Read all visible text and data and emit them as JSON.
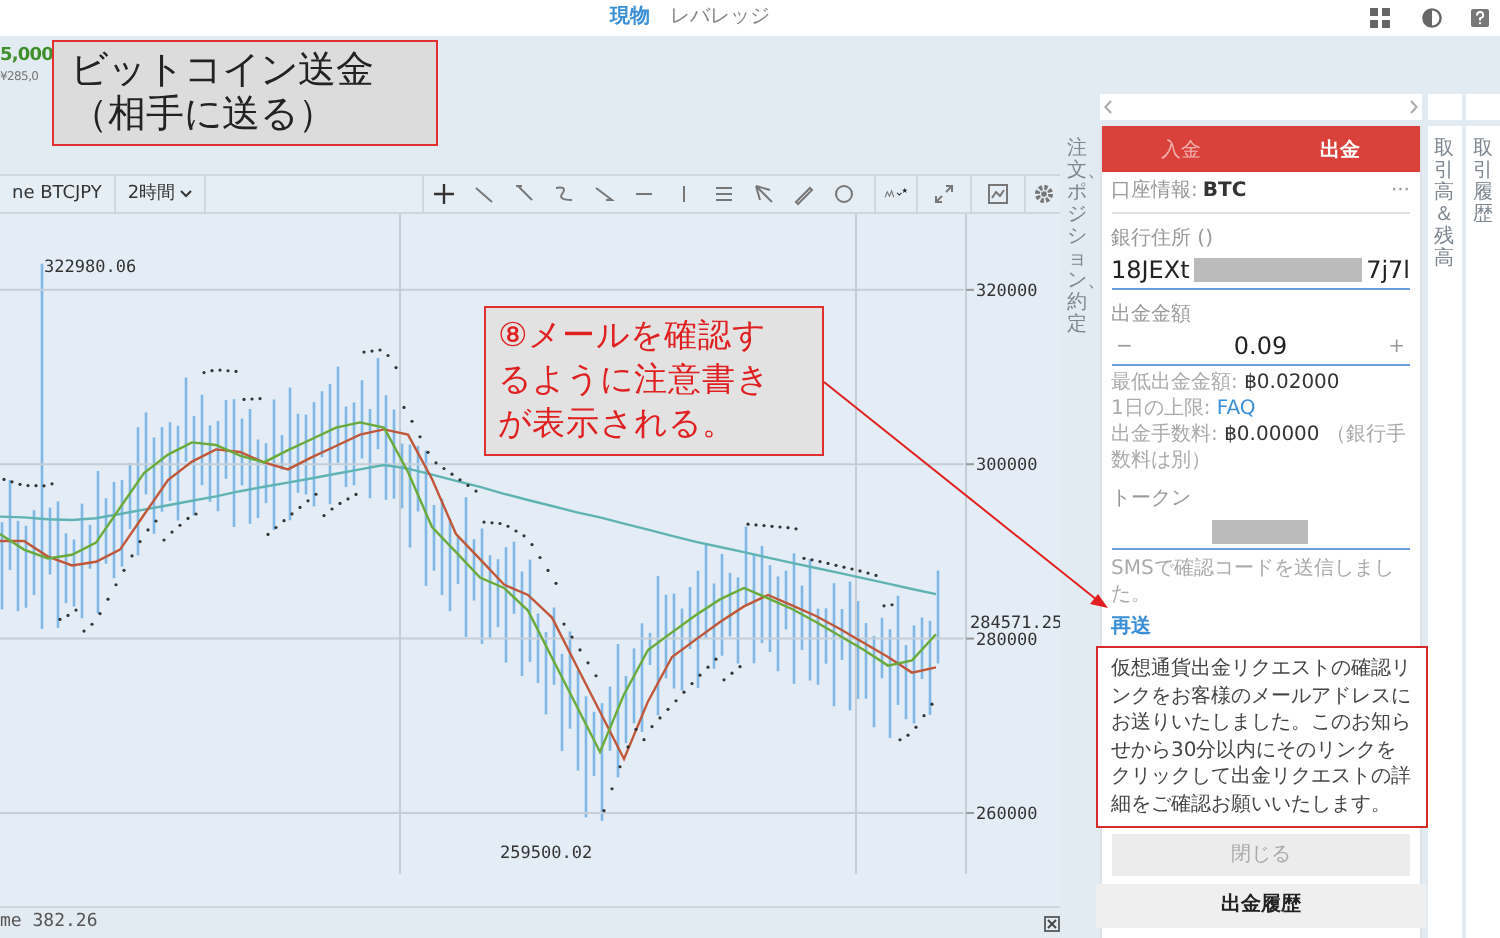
{
  "top_nav": {
    "tabs": [
      {
        "label": "現物",
        "selected": true
      },
      {
        "label": "レバレッジ",
        "selected": false
      }
    ]
  },
  "ticker": {
    "price": "5,000",
    "sub_price": "¥285,0"
  },
  "callout_title": {
    "lines": [
      "ビットコイン送金",
      "（相手に送る）"
    ]
  },
  "callout_note": {
    "lines": [
      "⑧メールを確認す",
      "るように注意書き",
      "が表示される。"
    ]
  },
  "chart": {
    "symbol": "ne BTCJPY",
    "interval": "2時間",
    "high_label": "322980.06",
    "low_label": "259500.02",
    "last_price": "284571.25",
    "volume_label": "me 382.26",
    "chart_data": {
      "type": "line",
      "grid": true,
      "yticks": [
        260000,
        280000,
        300000,
        320000
      ],
      "ylim": [
        253000,
        328700
      ],
      "series": [
        {
          "color": "#5fb3b3",
          "values": [
            294000,
            293900,
            293700,
            293600,
            293800,
            294300,
            294800,
            295300,
            295800,
            296300,
            296900,
            297400,
            297900,
            298400,
            298900,
            299400,
            299900,
            299500,
            298800,
            298100,
            297400,
            296600,
            295900,
            295200,
            294500,
            293900,
            293200,
            292500,
            291800,
            291100,
            290500,
            289900,
            289300,
            288700,
            288100,
            287500,
            286900,
            286300,
            285700,
            285100
          ]
        },
        {
          "color": "#c0573a",
          "values": [
            291200,
            291200,
            289400,
            288400,
            288800,
            290200,
            294200,
            298200,
            300300,
            301700,
            301400,
            300200,
            299400,
            300800,
            302100,
            303400,
            304000,
            303400,
            298300,
            292000,
            289100,
            286200,
            285000,
            282400,
            277000,
            271600,
            266200,
            272800,
            277900,
            279900,
            281900,
            283700,
            285000,
            283800,
            282600,
            281100,
            279500,
            277900,
            276100,
            276700
          ]
        },
        {
          "color": "#6aaa3a",
          "values": [
            292000,
            290200,
            289200,
            289600,
            291000,
            295000,
            299000,
            301100,
            302500,
            302200,
            301000,
            300200,
            301600,
            302900,
            304200,
            304800,
            304200,
            299100,
            292800,
            289900,
            287000,
            285800,
            283200,
            277800,
            272400,
            267000,
            273600,
            278700,
            280700,
            282700,
            284500,
            285800,
            284600,
            283400,
            281900,
            280300,
            278700,
            276900,
            277500,
            280500
          ]
        }
      ]
    }
  },
  "left_side_tab": {
    "label": "注文、ポジション、約定"
  },
  "right_side_tabs": [
    {
      "label": "取引高＆残高"
    },
    {
      "label": "取引履歴"
    }
  ],
  "panel": {
    "tabs": [
      {
        "label": "入金",
        "selected": false
      },
      {
        "label": "出金",
        "selected": true
      }
    ],
    "account_label": "口座情報:",
    "account_value": "BTC",
    "more": "···",
    "address": {
      "label": "銀行住所 ()",
      "value_start": "18JEXt",
      "value_end": "7j7l"
    },
    "amount": {
      "label": "出金金額",
      "minus": "−",
      "value": "0.09",
      "plus": "+"
    },
    "info": [
      {
        "label": "最低出金金額:",
        "value": "฿0.02000",
        "kind": "value"
      },
      {
        "label": "1日の上限:",
        "value": "FAQ",
        "kind": "link"
      },
      {
        "label": "出金手数料:",
        "value": "฿0.00000",
        "note": "（銀行手数料は別）",
        "kind": "value"
      }
    ],
    "token": {
      "label": "トークン"
    },
    "sms_message": "SMSで確認コードを送信しました。",
    "resend": "再送",
    "notice": "仮想通貨出金リクエストの確認リンクをお客様のメールアドレスにお送りいたしました。このお知らせから30分以内にそのリンクをクリックして出金リクエストの詳細をご確認お願いいたします。",
    "close_button": {
      "label": "閉じる",
      "disabled": true
    },
    "history_title": "出金履歴"
  }
}
